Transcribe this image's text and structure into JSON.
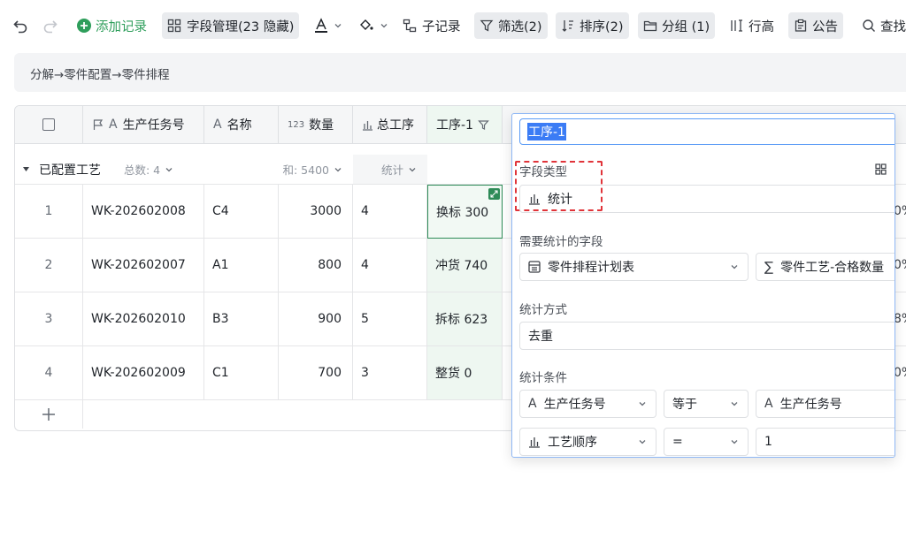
{
  "toolbar": {
    "add_record": "添加记录",
    "field_manage": "字段管理(23 隐藏)",
    "sub_record": "子记录",
    "filter": "筛选(2)",
    "sort": "排序(2)",
    "group": "分组 (1)",
    "row_height": "行高",
    "notice": "公告",
    "search": "查找"
  },
  "breadcrumb": "分解→零件配置→零件排程",
  "table": {
    "headers": {
      "task_no": "生产任务号",
      "name": "名称",
      "qty": "数量",
      "qty_prefix": "123",
      "total_process": "总工序",
      "process1": "工序-1"
    },
    "group": {
      "title": "已配置工艺",
      "count": "总数: 4",
      "sum": "和: 5400",
      "stat": "统计"
    },
    "rows": [
      {
        "idx": "1",
        "task": "WK-202602008",
        "name": "C4",
        "qty": "3000",
        "total": "4",
        "p1": "换标 300",
        "right": "0%"
      },
      {
        "idx": "2",
        "task": "WK-202602007",
        "name": "A1",
        "qty": "800",
        "total": "4",
        "p1": "冲货 740",
        "right": "0%"
      },
      {
        "idx": "3",
        "task": "WK-202602010",
        "name": "B3",
        "qty": "900",
        "total": "5",
        "p1": "拆标 623",
        "right": "8%"
      },
      {
        "idx": "4",
        "task": "WK-202602009",
        "name": "C1",
        "qty": "700",
        "total": "3",
        "p1": "整货 0",
        "right": "0%"
      }
    ]
  },
  "popup": {
    "field_name": "工序-1",
    "field_type_label": "字段类型",
    "field_type": "统计",
    "stat_field_label": "需要统计的字段",
    "stat_table": "零件排程计划表",
    "stat_field": "零件工艺-合格数量",
    "method_label": "统计方式",
    "method": "去重",
    "condition_label": "统计条件",
    "cond1_field": "生产任务号",
    "cond1_op": "等于",
    "cond1_value": "生产任务号",
    "cond2_field": "工艺顺序",
    "cond2_op": "=",
    "cond2_value": "1"
  }
}
